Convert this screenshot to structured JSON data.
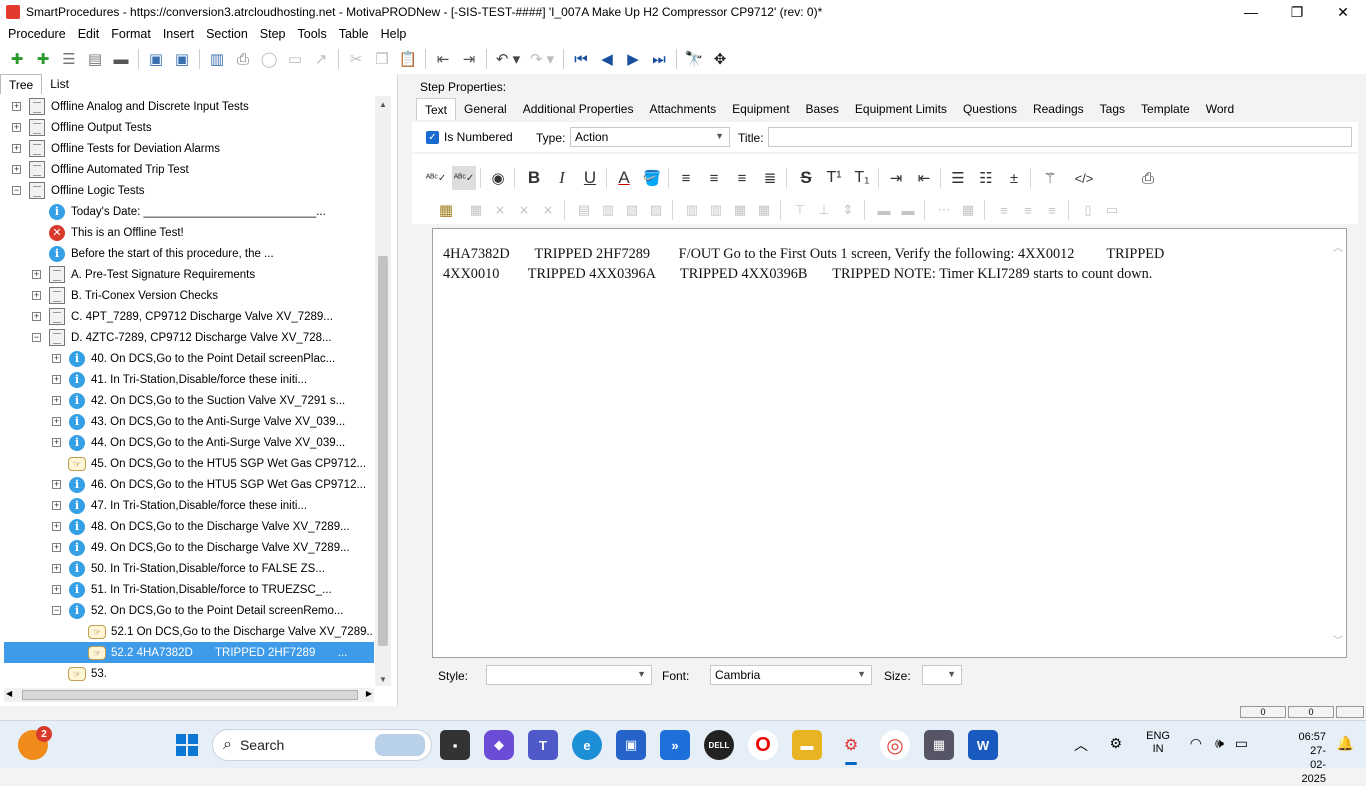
{
  "window": {
    "title": "SmartProcedures - https://conversion3.atrcloudhosting.net - MotivaPRODNew - [-SIS-TEST-####] 'I_007A Make Up H2 Compressor CP9712' (rev: 0)*"
  },
  "menu": [
    "Procedure",
    "Edit",
    "Format",
    "Insert",
    "Section",
    "Step",
    "Tools",
    "Table",
    "Help"
  ],
  "left_tabs": [
    "Tree",
    "List"
  ],
  "tree": [
    {
      "label": "Offline Analog and Discrete Input Tests",
      "icon": "document-icon",
      "expander": "+"
    },
    {
      "label": "Offline Output Tests",
      "icon": "document-icon",
      "expander": "+"
    },
    {
      "label": "Offline Tests for Deviation Alarms",
      "icon": "document-icon",
      "expander": "+"
    },
    {
      "label": "Offline Automated Trip Test",
      "icon": "document-icon",
      "expander": "+"
    },
    {
      "label": "Offline Logic Tests",
      "icon": "document-icon",
      "expander": "−"
    },
    {
      "label": "Today's Date: ___________________________...",
      "icon": "info-icon",
      "expander": ""
    },
    {
      "label": "This is an Offline Test!",
      "icon": "error-icon",
      "expander": ""
    },
    {
      "label": "Before the start of this procedure, the ...",
      "icon": "info-icon",
      "expander": ""
    },
    {
      "label": "A. Pre-Test Signature Requirements",
      "icon": "document-icon",
      "expander": "+"
    },
    {
      "label": "B. Tri-Conex Version Checks",
      "icon": "document-icon",
      "expander": "+"
    },
    {
      "label": "C. 4PT_7289, CP9712 Discharge Valve XV_7289...",
      "icon": "document-icon",
      "expander": "+"
    },
    {
      "label": "D. 4ZTC-7289, CP9712 Discharge Valve XV_728...",
      "icon": "document-icon",
      "expander": "−"
    },
    {
      "label": "40. On DCS,Go to the Point Detail screenPlac...",
      "icon": "info-icon",
      "expander": "+"
    },
    {
      "label": "41. In Tri-Station,Disable/force these initi...",
      "icon": "info-icon",
      "expander": "+"
    },
    {
      "label": "42. On DCS,Go to the Suction Valve XV_7291 s...",
      "icon": "info-icon",
      "expander": "+"
    },
    {
      "label": "43. On DCS,Go to the Anti-Surge Valve XV_039...",
      "icon": "info-icon",
      "expander": "+"
    },
    {
      "label": "44. On DCS,Go to the Anti-Surge Valve XV_039...",
      "icon": "info-icon",
      "expander": "+"
    },
    {
      "label": "45. On DCS,Go to the HTU5 SGP Wet Gas CP9712...",
      "icon": "hand-pointer-icon",
      "expander": ""
    },
    {
      "label": "46. On DCS,Go to the HTU5 SGP Wet Gas CP9712...",
      "icon": "info-icon",
      "expander": "+"
    },
    {
      "label": "47. In Tri-Station,Disable/force these initi...",
      "icon": "info-icon",
      "expander": "+"
    },
    {
      "label": "48. On DCS,Go to the Discharge Valve XV_7289...",
      "icon": "info-icon",
      "expander": "+"
    },
    {
      "label": "49. On DCS,Go to the Discharge Valve XV_7289...",
      "icon": "info-icon",
      "expander": "+"
    },
    {
      "label": "50. In Tri-Station,Disable/force to FALSE ZS...",
      "icon": "info-icon",
      "expander": "+"
    },
    {
      "label": "51. In Tri-Station,Disable/force to TRUEZSC_...",
      "icon": "info-icon",
      "expander": "+"
    },
    {
      "label": "52. On DCS,Go to the Point Detail screenRemo...",
      "icon": "info-icon",
      "expander": "−"
    },
    {
      "label": "52.1 On DCS,Go to the Discharge Valve XV_7289...",
      "icon": "hand-pointer-icon",
      "expander": ""
    },
    {
      "label": "52.2 4HA7382D       TRIPPED 2HF7289       ...",
      "icon": "hand-pointer-icon",
      "expander": "",
      "selected": true
    },
    {
      "label": "53.",
      "icon": "hand-pointer-icon",
      "expander": ""
    }
  ],
  "right": {
    "step_properties_label": "Step Properties:",
    "tabs": [
      "Text",
      "General",
      "Additional Properties",
      "Attachments",
      "Equipment",
      "Bases",
      "Equipment Limits",
      "Questions",
      "Readings",
      "Tags",
      "Template",
      "Word"
    ],
    "is_numbered_label": "Is Numbered",
    "type_label": "Type:",
    "type_value": "Action",
    "title_label": "Title:",
    "title_value": "",
    "editor_text": "4HA7382D       TRIPPED 2HF7289        F/OUT Go to the First Outs 1 screen, Verify the following: 4XX0012         TRIPPED\n4XX0010        TRIPPED 4XX0396A       TRIPPED 4XX0396B       TRIPPED NOTE: Timer KLI7289 starts to count down.",
    "style_label": "Style:",
    "style_value": "",
    "font_label": "Font:",
    "font_value": "Cambria",
    "size_label": "Size:",
    "size_value": ""
  },
  "status": {
    "cell1": "0",
    "cell2": "0"
  },
  "taskbar": {
    "search_label": "Search",
    "notification_count": "2",
    "lang_line1": "ENG",
    "lang_line2": "IN",
    "time": "06:57",
    "date": "27-02-2025"
  },
  "colors": {
    "selection": "#3d9bea",
    "accent": "#1a6bd0"
  }
}
